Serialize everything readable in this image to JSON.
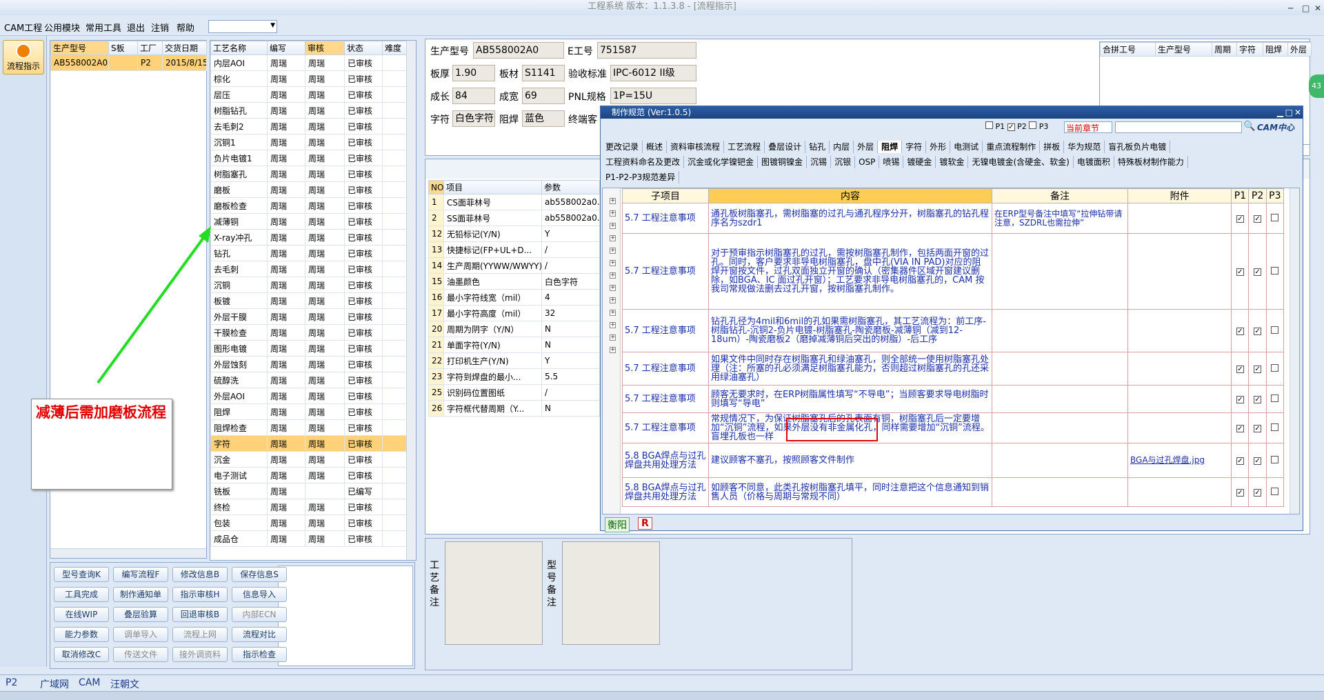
{
  "window": {
    "title": "工程系统 版本：1.1.3.8 - [流程指示]"
  },
  "menu": {
    "items": [
      "CAM工程",
      "公用模块",
      "常用工具",
      "退出",
      "注销",
      "帮助"
    ]
  },
  "leftnav": {
    "flow_label": "流程指示"
  },
  "order_grid": {
    "headers": [
      "生产型号",
      "S板",
      "工厂",
      "交货日期"
    ],
    "row": [
      "AB558002A0",
      "",
      "P2",
      "2015/8/15"
    ]
  },
  "process_grid": {
    "headers": [
      "工艺名称",
      "编写",
      "审核",
      "状态",
      "难度"
    ],
    "rows": [
      [
        "内层AOI",
        "周瑞",
        "周瑞",
        "已审核"
      ],
      [
        "棕化",
        "周瑞",
        "周瑞",
        "已审核"
      ],
      [
        "层压",
        "周瑞",
        "周瑞",
        "已审核"
      ],
      [
        "树脂钻孔",
        "周瑞",
        "周瑞",
        "已审核"
      ],
      [
        "去毛刺2",
        "周瑞",
        "周瑞",
        "已审核"
      ],
      [
        "沉铜1",
        "周瑞",
        "周瑞",
        "已审核"
      ],
      [
        "负片电镀1",
        "周瑞",
        "周瑞",
        "已审核"
      ],
      [
        "树脂塞孔",
        "周瑞",
        "周瑞",
        "已审核"
      ],
      [
        "磨板",
        "周瑞",
        "周瑞",
        "已审核"
      ],
      [
        "磨板检查",
        "周瑞",
        "周瑞",
        "已审核"
      ],
      [
        "减薄铜",
        "周瑞",
        "周瑞",
        "已审核"
      ],
      [
        "X-ray冲孔",
        "周瑞",
        "周瑞",
        "已审核"
      ],
      [
        "钻孔",
        "周瑞",
        "周瑞",
        "已审核"
      ],
      [
        "去毛刺",
        "周瑞",
        "周瑞",
        "已审核"
      ],
      [
        "沉铜",
        "周瑞",
        "周瑞",
        "已审核"
      ],
      [
        "板镀",
        "周瑞",
        "周瑞",
        "已审核"
      ],
      [
        "外层干膜",
        "周瑞",
        "周瑞",
        "已审核"
      ],
      [
        "干膜检查",
        "周瑞",
        "周瑞",
        "已审核"
      ],
      [
        "图形电镀",
        "周瑞",
        "周瑞",
        "已审核"
      ],
      [
        "外层蚀刻",
        "周瑞",
        "周瑞",
        "已审核"
      ],
      [
        "硫醇洗",
        "周瑞",
        "周瑞",
        "已审核"
      ],
      [
        "外层AOI",
        "周瑞",
        "周瑞",
        "已审核"
      ],
      [
        "阻焊",
        "周瑞",
        "周瑞",
        "已审核"
      ],
      [
        "阻焊检查",
        "周瑞",
        "周瑞",
        "已审核"
      ],
      [
        "字符",
        "周瑞",
        "周瑞",
        "已审核"
      ],
      [
        "沉金",
        "周瑞",
        "周瑞",
        "已审核"
      ],
      [
        "电子测试",
        "周瑞",
        "周瑞",
        "已审核"
      ],
      [
        "铣板",
        "周瑞",
        "",
        "已编写"
      ],
      [
        "终检",
        "周瑞",
        "周瑞",
        "已审核"
      ],
      [
        "包装",
        "周瑞",
        "周瑞",
        "已审核"
      ],
      [
        "成品仓",
        "周瑞",
        "周瑞",
        "已审核"
      ]
    ]
  },
  "annotation": {
    "text": "减薄后需加磨板流程"
  },
  "buttons": [
    [
      "型号查询K",
      "编写流程F",
      "修改信息B",
      "保存信息S"
    ],
    [
      "工具完成",
      "制作通知单",
      "指示审核H",
      "信息导入"
    ],
    [
      "在线WIP",
      "叠层验算",
      "回退审核B",
      "内部ECN"
    ],
    [
      "能力参数",
      "调单导入",
      "流程上网",
      "流程对比"
    ],
    [
      "取消修改C",
      "传送文件",
      "接外调资料",
      "指示检查"
    ]
  ],
  "info": {
    "model_label": "生产型号",
    "model": "AB558002A0",
    "eng_label": "E工号",
    "eng": "751587",
    "thick_label": "板厚",
    "thick": "1.90",
    "mat_label": "板材",
    "mat": "S1141",
    "std_label": "验收标准",
    "std": "IPC-6012 II级",
    "cheng_label": "成长",
    "cheng": "84",
    "kuan_label": "成宽",
    "kuan": "69",
    "pnl_label": "PNL规格",
    "pnl": "1P=15U",
    "char_label": "字符",
    "char": "白色字符",
    "mask_label": "阻焊",
    "mask": "蓝色",
    "end_label": "终端客"
  },
  "right_grid": {
    "headers": [
      "合拼工号",
      "生产型号",
      "周期",
      "字符",
      "阻焊",
      "外层"
    ]
  },
  "param_grid": {
    "headers": [
      "NO",
      "项目",
      "参数"
    ],
    "rows": [
      [
        "1",
        "CS面菲林号",
        "ab558002a0."
      ],
      [
        "2",
        "SS面菲林号",
        "ab558002a0."
      ],
      [
        "12",
        "无铅标记(Y/N)",
        "Y"
      ],
      [
        "13",
        "快捷标记(FP+UL+D...",
        "/"
      ],
      [
        "14",
        "生产周期(YYWW/WWYY)",
        "/"
      ],
      [
        "15",
        "油墨颜色",
        "白色字符"
      ],
      [
        "16",
        "最小字符线宽（mil）",
        "4"
      ],
      [
        "17",
        "最小字符高度（mil）",
        "32"
      ],
      [
        "20",
        "周期为阴字（Y/N）",
        "N"
      ],
      [
        "21",
        "单面字符(Y/N)",
        "N"
      ],
      [
        "22",
        "打印机生产(Y/N)",
        "Y"
      ],
      [
        "23",
        "字符到焊盘的最小...",
        "5.5"
      ],
      [
        "25",
        "识别码位置图纸",
        "/"
      ],
      [
        "26",
        "字符框代替周期（Y...",
        "N"
      ]
    ]
  },
  "notes": {
    "process_label": "工艺备注",
    "model_label": "型号备注"
  },
  "dialog": {
    "title": "制作规范 (Ver:1.0.5)",
    "p1": "P1",
    "p2": "P2",
    "p3": "P3",
    "chapter": "当前章节",
    "cam_logo": "CAM中心",
    "tabs1": [
      "更改记录",
      "概述",
      "资料审核流程",
      "工艺流程",
      "叠层设计",
      "钻孔",
      "内层",
      "外层",
      "阻焊",
      "字符",
      "外形",
      "电测试",
      "重点流程制作",
      "拼板",
      "华为规范",
      "盲孔板负片电镀"
    ],
    "tabs2": [
      "工程资料命名及更改",
      "沉金或化学镍钯金",
      "图镀铜镍金",
      "沉锡",
      "沉银",
      "OSP",
      "喷锡",
      "镀硬金",
      "镀软金",
      "无镍电镀金(含硬金、软金)",
      "电镀面积",
      "特殊板材制作能力"
    ],
    "tab3": "P1-P2-P3规范差异",
    "headers": [
      "子项目",
      "内容",
      "备注",
      "附件",
      "P1",
      "P2",
      "P3"
    ],
    "rows": [
      {
        "sub": "5.7 工程注意事项",
        "content": "通孔板树脂塞孔，需树脂塞的过孔与通孔程序分开，树脂塞孔的钻孔程序名为szdr1",
        "note": "在ERP型号备注中填写“拉伸钻带请注意，SZDRL也需拉伸”",
        "att": "",
        "p1": true,
        "p2": true,
        "p3": false
      },
      {
        "sub": "5.7 工程注意事项",
        "content": "对于预审指示树脂塞孔的过孔，需按树脂塞孔制作，包括两面开窗的过孔。同时，客户要求非导电树脂塞孔，盘中孔(VIA IN PAD)对应的阻焊开窗按文件，过孔双面独立开窗的确认（密集器件区域开窗建议删除，如BGA、IC 面过孔开窗）；工艺要求非导电树脂塞孔的，CAM 按我司常规做法删去过孔开窗，按树脂塞孔制作。",
        "note": "",
        "att": "",
        "p1": true,
        "p2": true,
        "p3": false
      },
      {
        "sub": "5.7 工程注意事项",
        "content": "钻孔孔径为4mil和6mil的孔如果需树脂塞孔，其工艺流程为：前工序-树脂钻孔-沉铜2-负片电镀-树脂塞孔-陶瓷磨板-减薄铜（减到12-18um）-陶瓷磨板2（磨掉减薄铜后突出的树脂）-后工序",
        "note": "",
        "att": "",
        "p1": true,
        "p2": true,
        "p3": false
      },
      {
        "sub": "5.7 工程注意事项",
        "content": "如果文件中同时存在树脂塞孔和绿油塞孔，则全部统一使用树脂塞孔处理（注：所塞的孔必须满足树脂塞孔能力，否则超过树脂塞孔的孔还采用绿油塞孔）",
        "note": "",
        "att": "",
        "p1": true,
        "p2": true,
        "p3": false
      },
      {
        "sub": "5.7 工程注意事项",
        "content": "顾客无要求时，在ERP树脂属性填写“不导电”；当顾客要求导电树脂时则填写“导电”",
        "note": "",
        "att": "",
        "p1": true,
        "p2": true,
        "p3": false
      },
      {
        "sub": "5.7 工程注意事项",
        "content": "常规情况下，为保证树脂塞孔后的孔表面有铜，树脂塞孔后一定要增加“沉铜”流程，如果外层没有非金属化孔，同样需要增加“沉铜”流程。盲埋孔板也一样",
        "note": "",
        "att": "",
        "p1": true,
        "p2": true,
        "p3": false
      },
      {
        "sub": "5.8 BGA焊点与过孔焊盘共用处理方法",
        "content": "建议顾客不塞孔，按照顾客文件制作",
        "note": "",
        "att": "BGA与过孔焊盘.jpg",
        "p1": true,
        "p2": true,
        "p3": false
      },
      {
        "sub": "5.8 BGA焊点与过孔焊盘共用处理方法",
        "content": "如顾客不同意，此类孔按树脂塞孔填平，同时注意把这个信息通知到销售人员（价格与周期与常规不同）",
        "note": "",
        "att": "",
        "p1": true,
        "p2": true,
        "p3": false
      }
    ],
    "footer1": "衡阳",
    "footer2": "R"
  },
  "status": {
    "factory": "P2",
    "s1": "广域网",
    "s2": "CAM",
    "s3": "汪朝文"
  },
  "colors": {
    "accent": "#ffd88c",
    "dialog_title": "#1c4382",
    "annotation": "#e00000",
    "arrow": "#22dd22"
  }
}
